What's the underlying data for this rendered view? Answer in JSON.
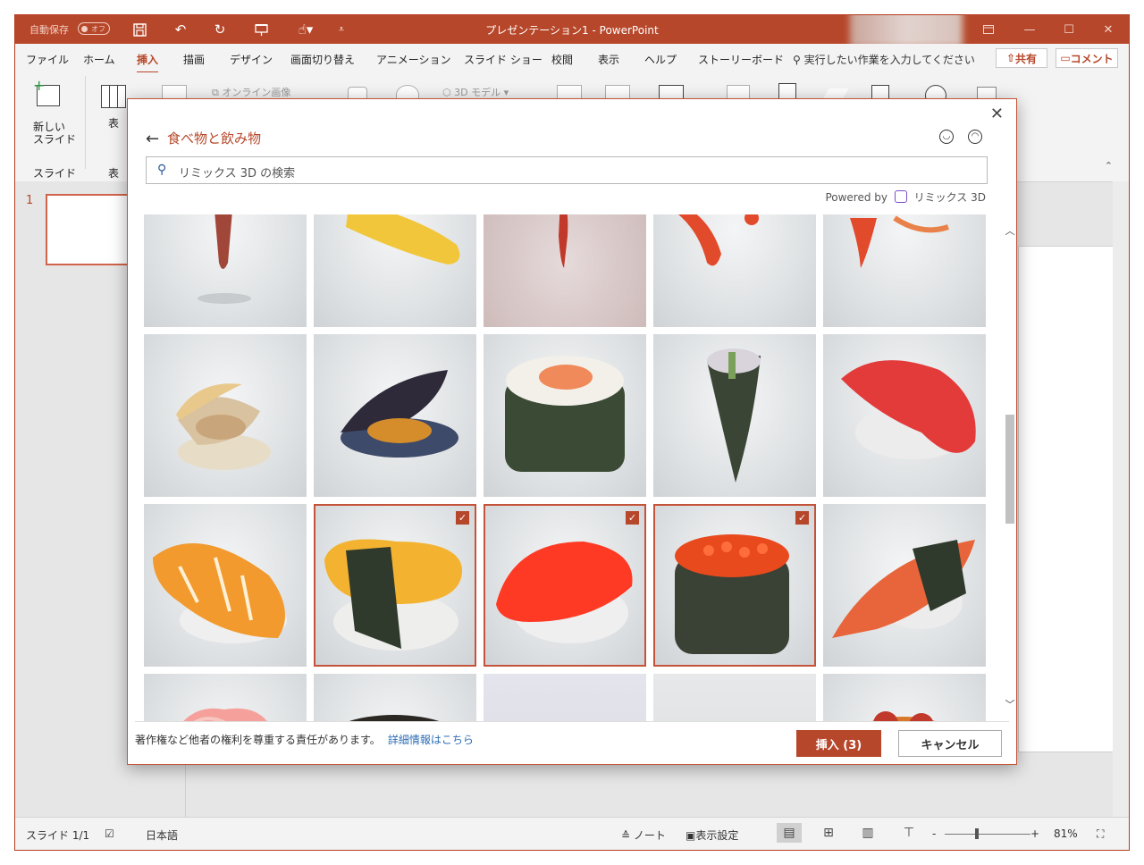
{
  "titlebar": {
    "autosave_label": "自動保存",
    "autosave_state": "オフ",
    "title": "プレゼンテーション1 - PowerPoint",
    "quick_access_icons": [
      "save-icon",
      "undo-icon",
      "redo-icon",
      "present-icon",
      "touch-mode-icon",
      "customize-icon"
    ],
    "window_controls": [
      "ribbon-display-icon",
      "minimize-icon",
      "restore-icon",
      "close-icon"
    ]
  },
  "ribbon_tabs": [
    "ファイル",
    "ホーム",
    "挿入",
    "描画",
    "デザイン",
    "画面切り替え",
    "アニメーション",
    "スライド ショー",
    "校閲",
    "表示",
    "ヘルプ",
    "ストーリーボード"
  ],
  "active_tab": "挿入",
  "tell_me": "実行したい作業を入力してください",
  "share_label": "共有",
  "comment_label": "コメント",
  "ribbon": {
    "new_slide": "新しい\nスライド",
    "table": "表",
    "group_slides": "スライド",
    "group_tables": "表",
    "online_images": "オンライン画像",
    "models_3d": "3D モデル"
  },
  "slide_pane": {
    "slide_number": "1"
  },
  "statusbar": {
    "slide_info": "スライド 1/1",
    "language": "日本語",
    "notes": "ノート",
    "display_settings": "表示設定",
    "zoom": "81%",
    "zoom_level": 0.81
  },
  "dialog": {
    "category_title": "食べ物と飲み物",
    "search_placeholder": "リミックス 3D の検索",
    "powered_by": "Powered by",
    "powered_name": "リミックス 3D",
    "notice": "著作権など他者の権利を尊重する責任があります。",
    "notice_link": "詳細情報はこちら",
    "insert_button": "挿入 (3)",
    "cancel_button": "キャンセル",
    "accent_color": "#b7472a",
    "items": [
      {
        "name": "sweet-potato",
        "selected": false
      },
      {
        "name": "corn",
        "selected": false
      },
      {
        "name": "chili",
        "selected": false
      },
      {
        "name": "lobster",
        "selected": false
      },
      {
        "name": "shrimp",
        "selected": false
      },
      {
        "name": "clam",
        "selected": false
      },
      {
        "name": "mussel",
        "selected": false
      },
      {
        "name": "salmon-maki",
        "selected": false
      },
      {
        "name": "temaki",
        "selected": false
      },
      {
        "name": "tuna-nigiri",
        "selected": false
      },
      {
        "name": "ebi-nigiri",
        "selected": true
      },
      {
        "name": "tamago-nigiri",
        "selected": true
      },
      {
        "name": "maguro-nigiri",
        "selected": true
      },
      {
        "name": "ikura-gunkan",
        "selected": true
      },
      {
        "name": "unagi-nigiri",
        "selected": false
      },
      {
        "name": "gari-ginger",
        "selected": false
      },
      {
        "name": "soy-sauce-bowl",
        "selected": false
      },
      {
        "name": "loading-tile",
        "selected": false
      },
      {
        "name": "loading-tile-2",
        "selected": false
      },
      {
        "name": "spaghetti-meatballs",
        "selected": false
      }
    ]
  }
}
